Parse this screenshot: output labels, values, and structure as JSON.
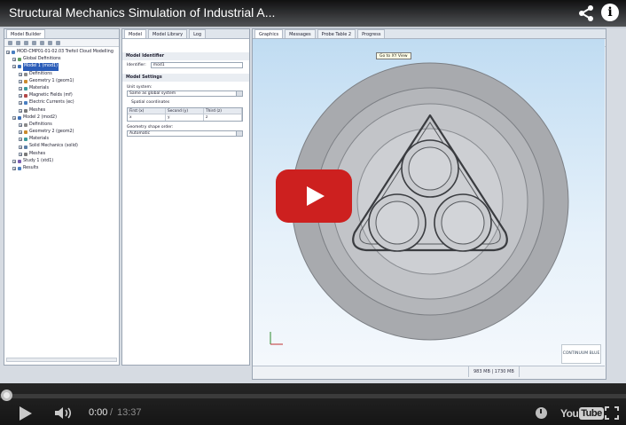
{
  "player": {
    "title": "Structural Mechanics Simulation of Industrial A...",
    "time_current": "0:00",
    "time_separator": "/",
    "time_total": "13:37",
    "progress_fraction": 0,
    "logo_you": "You",
    "logo_tube": "Tube",
    "accent_color": "#cc181e"
  },
  "app": {
    "tabs_left": [
      "Model Builder"
    ],
    "tabs_mid": [
      "Model",
      "Model Library",
      "Log"
    ],
    "tabs_right": [
      "Graphics",
      "Messages",
      "Probe Table 2",
      "Progress"
    ],
    "tree": [
      {
        "text": "MOD-CMP01-01-02.03 Trefoil Cloud Modelling",
        "depth": 0,
        "icon": "#4a7fc1"
      },
      {
        "text": "Global Definitions",
        "depth": 1,
        "icon": "#5f9d5f"
      },
      {
        "text": "Model 1 (mod1)",
        "depth": 1,
        "icon": "#3a6fb8",
        "selected": true
      },
      {
        "text": "Definitions",
        "depth": 2,
        "icon": "#8a8a8a"
      },
      {
        "text": "Geometry 1 (geom1)",
        "depth": 2,
        "icon": "#c98b2f"
      },
      {
        "text": "Materials",
        "depth": 2,
        "icon": "#3a9a9a"
      },
      {
        "text": "Magnetic Fields (mf)",
        "depth": 2,
        "icon": "#b24848"
      },
      {
        "text": "Electric Currents (ec)",
        "depth": 2,
        "icon": "#4a7fc1"
      },
      {
        "text": "Meshes",
        "depth": 2,
        "icon": "#7a7a7a"
      },
      {
        "text": "Model 2 (mod2)",
        "depth": 1,
        "icon": "#3a6fb8"
      },
      {
        "text": "Definitions",
        "depth": 2,
        "icon": "#8a8a8a"
      },
      {
        "text": "Geometry 2 (geom2)",
        "depth": 2,
        "icon": "#c98b2f"
      },
      {
        "text": "Materials",
        "depth": 2,
        "icon": "#3a9a9a"
      },
      {
        "text": "Solid Mechanics (solid)",
        "depth": 2,
        "icon": "#5b7fa8"
      },
      {
        "text": "Meshes",
        "depth": 2,
        "icon": "#7a7a7a"
      },
      {
        "text": "Study 1 (std1)",
        "depth": 1,
        "icon": "#7a5fb0"
      },
      {
        "text": "Results",
        "depth": 1,
        "icon": "#4a7fc1"
      }
    ],
    "settings": {
      "identifier_header": "Model Identifier",
      "identifier_label": "Identifier:",
      "identifier_value": "mod1",
      "settings_header": "Model Settings",
      "unit_label": "Unit system:",
      "unit_value": "Same as global system",
      "coords_label": "Spatial coordinates",
      "coord_headers": [
        "First (x)",
        "Second (y)",
        "Third (z)"
      ],
      "coord_values": [
        "x",
        "y",
        "z"
      ],
      "shape_label": "Geometry shape order:",
      "shape_value": "Automatic"
    },
    "tooltip": "Go to XY View",
    "memory": "983 MB | 1730 MB",
    "badge": "CONTINUUM BLUE"
  }
}
